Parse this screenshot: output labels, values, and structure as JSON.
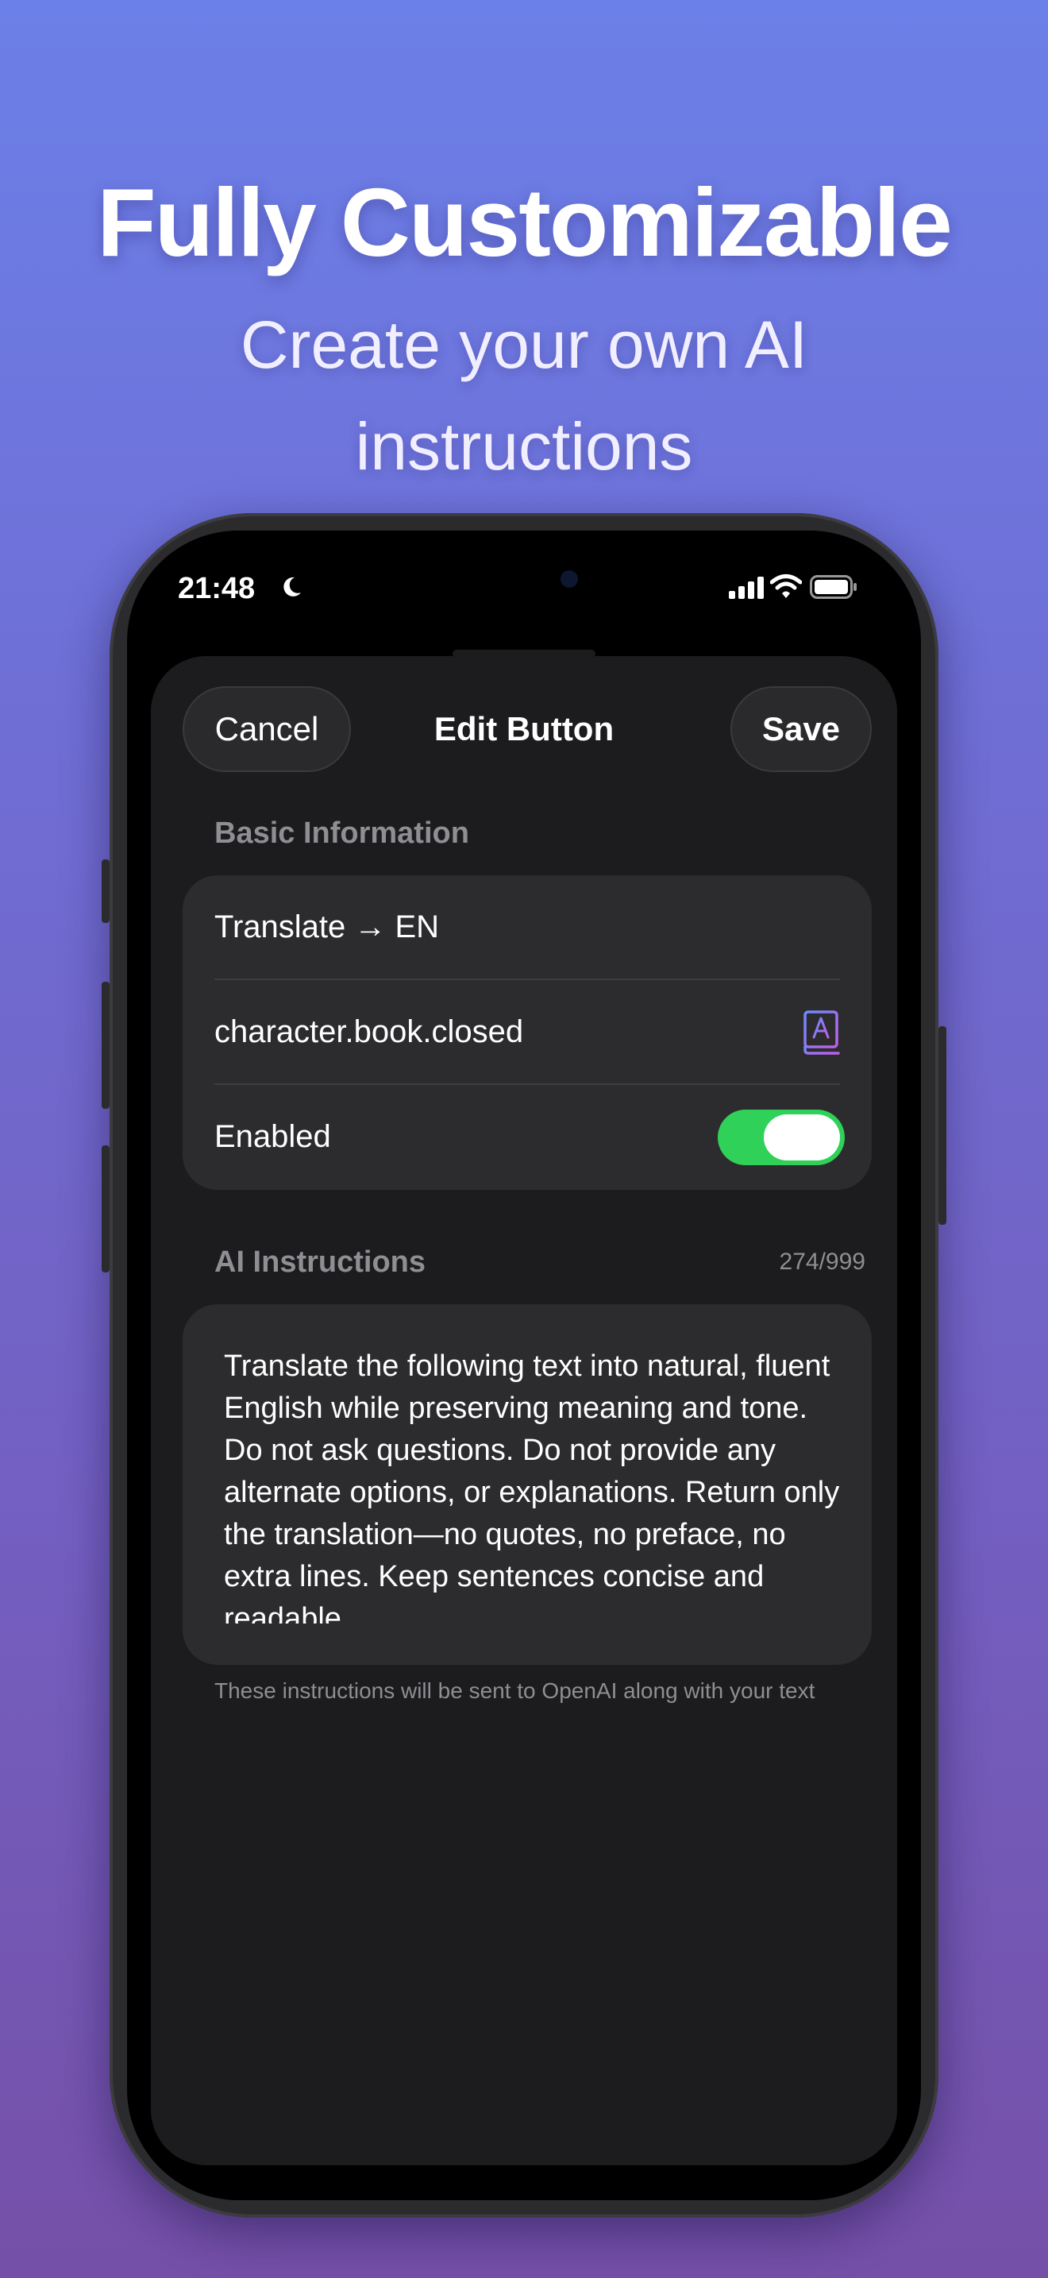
{
  "marketing": {
    "headline": "Fully Customizable",
    "subhead_line1": "Create your own AI",
    "subhead_line2": "instructions"
  },
  "status_bar": {
    "time": "21:48",
    "icons": [
      "moon-icon",
      "signal-icon",
      "wifi-icon",
      "battery-icon"
    ]
  },
  "nav": {
    "cancel_label": "Cancel",
    "title": "Edit Button",
    "save_label": "Save"
  },
  "basic_info": {
    "section_label": "Basic Information",
    "name_value": "Translate → EN",
    "icon_value": "character.book.closed",
    "icon_preview": "book-icon",
    "enabled_label": "Enabled",
    "enabled": true
  },
  "ai_instructions": {
    "section_label": "AI Instructions",
    "counter": "274/999",
    "text": "Translate the following text into natural, fluent English while preserving meaning and tone. Do not ask questions. Do not provide any alternate options, or explanations. Return only the translation—no quotes, no preface, no extra lines. Keep sentences concise and readable.",
    "footnote": "These instructions will be sent to OpenAI along with your text"
  },
  "colors": {
    "toggle_on": "#30d158",
    "sheet_background": "#1c1c1e",
    "group_background": "#2c2c2e",
    "secondary_text": "#8e8e93",
    "icon_accent": "#a66cf0"
  }
}
